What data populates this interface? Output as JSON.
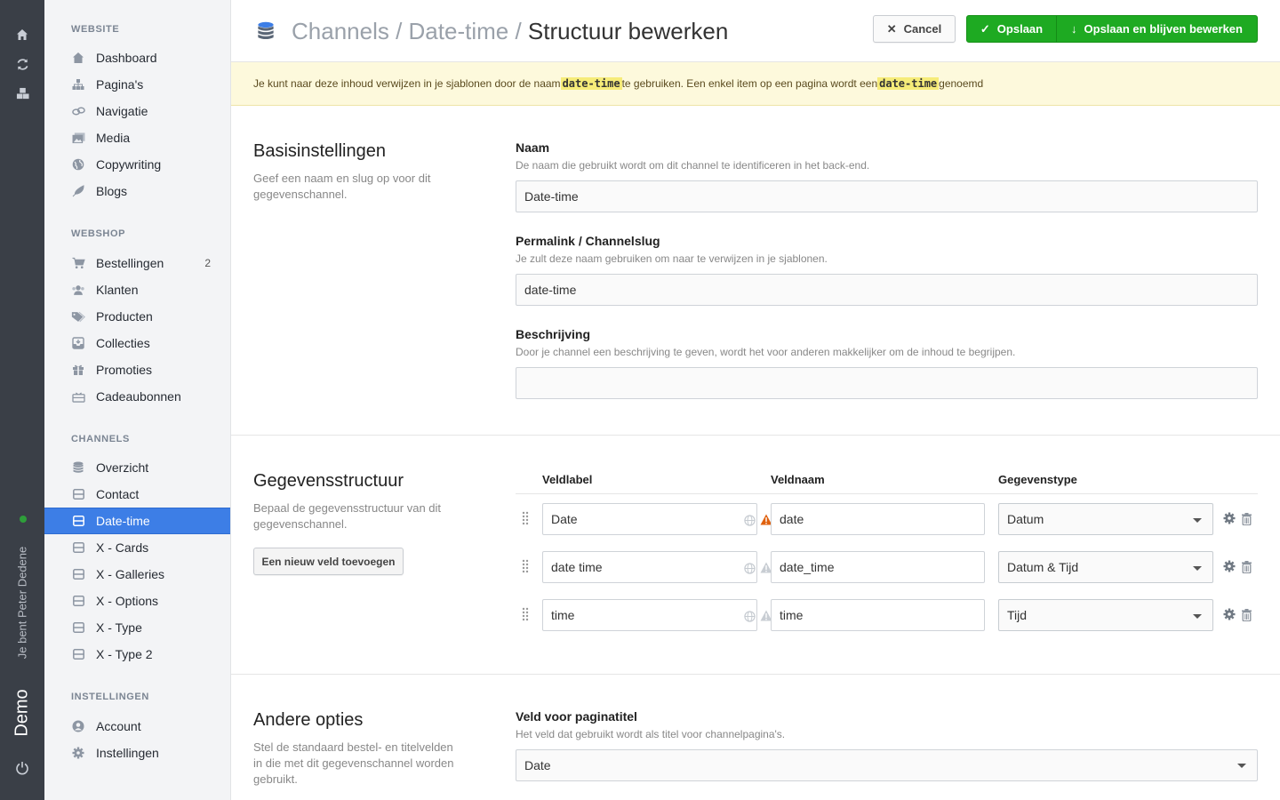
{
  "rail": {
    "user": "Je bent Peter Dedene",
    "site": "Demo"
  },
  "sidebar": {
    "website_heading": "WEBSITE",
    "website_items": [
      {
        "label": "Dashboard",
        "icon": "home-icon"
      },
      {
        "label": "Pagina's",
        "icon": "sitemap-icon"
      },
      {
        "label": "Navigatie",
        "icon": "link-icon"
      },
      {
        "label": "Media",
        "icon": "images-icon"
      },
      {
        "label": "Copywriting",
        "icon": "globe-icon"
      },
      {
        "label": "Blogs",
        "icon": "feather-icon"
      }
    ],
    "webshop_heading": "WEBSHOP",
    "webshop_items": [
      {
        "label": "Bestellingen",
        "icon": "cart-icon",
        "badge": "2"
      },
      {
        "label": "Klanten",
        "icon": "users-icon"
      },
      {
        "label": "Producten",
        "icon": "tags-icon"
      },
      {
        "label": "Collecties",
        "icon": "inbox-icon"
      },
      {
        "label": "Promoties",
        "icon": "gift-icon"
      },
      {
        "label": "Cadeaubonnen",
        "icon": "giftcard-icon"
      }
    ],
    "channels_heading": "CHANNELS",
    "channels_items": [
      {
        "label": "Overzicht",
        "icon": "database-icon"
      },
      {
        "label": "Contact",
        "icon": "channel-icon"
      },
      {
        "label": "Date-time",
        "icon": "channel-icon",
        "active": true
      },
      {
        "label": "X - Cards",
        "icon": "channel-icon"
      },
      {
        "label": "X - Galleries",
        "icon": "channel-icon"
      },
      {
        "label": "X - Options",
        "icon": "channel-icon"
      },
      {
        "label": "X - Type",
        "icon": "channel-icon"
      },
      {
        "label": "X - Type 2",
        "icon": "channel-icon"
      }
    ],
    "settings_heading": "INSTELLINGEN",
    "settings_items": [
      {
        "label": "Account",
        "icon": "user-circle-icon"
      },
      {
        "label": "Instellingen",
        "icon": "cog-icon"
      }
    ]
  },
  "header": {
    "crumb1": "Channels",
    "sep": " / ",
    "crumb2": "Date-time",
    "current": "Structuur bewerken",
    "cancel": "Cancel",
    "save": "Opslaan",
    "save_continue": "Opslaan en blijven bewerken"
  },
  "notice": {
    "part1": "Je kunt naar deze inhoud verwijzen in je sjablonen door de naam ",
    "code1": "date-time",
    "part2": " te gebruiken. Een enkel item op een pagina wordt een ",
    "code2": "date-time",
    "part3": " genoemd"
  },
  "basis": {
    "title": "Basisinstellingen",
    "desc": "Geef een naam en slug op voor dit gegevenschannel.",
    "name_label": "Naam",
    "name_help": "De naam die gebruikt wordt om dit channel te identificeren in het back-end.",
    "name_value": "Date-time",
    "slug_label": "Permalink / Channelslug",
    "slug_help": "Je zult deze naam gebruiken om naar te verwijzen in je sjablonen.",
    "slug_value": "date-time",
    "desc_label": "Beschrijving",
    "desc_help": "Door je channel een beschrijving te geven, wordt het voor anderen makkelijker om de inhoud te begrijpen.",
    "desc_value": ""
  },
  "structure": {
    "title": "Gegevensstructuur",
    "desc": "Bepaal de gegevensstructuur van dit gegevenschannel.",
    "add_button": "Een nieuw veld toevoegen",
    "col_label": "Veldlabel",
    "col_name": "Veldnaam",
    "col_type": "Gegevenstype",
    "rows": [
      {
        "label": "Date",
        "name": "date",
        "type": "Datum",
        "warning": true
      },
      {
        "label": "date time",
        "name": "date_time",
        "type": "Datum & Tijd",
        "warning": false
      },
      {
        "label": "time",
        "name": "time",
        "type": "Tijd",
        "warning": false
      }
    ]
  },
  "other": {
    "title": "Andere opties",
    "desc": "Stel de standaard bestel- en titelvelden in die met dit gegevenschannel worden gebruikt.",
    "title_field_label": "Veld voor paginatitel",
    "title_field_help": "Het veld dat gebruikt wordt als titel voor channelpagina's.",
    "title_field_value": "Date"
  },
  "colors": {
    "rail": "#3a3f47",
    "active": "#3d7ee6",
    "save": "#1eaa22",
    "notice": "#fdf9dc",
    "warning": "#e0610e"
  }
}
